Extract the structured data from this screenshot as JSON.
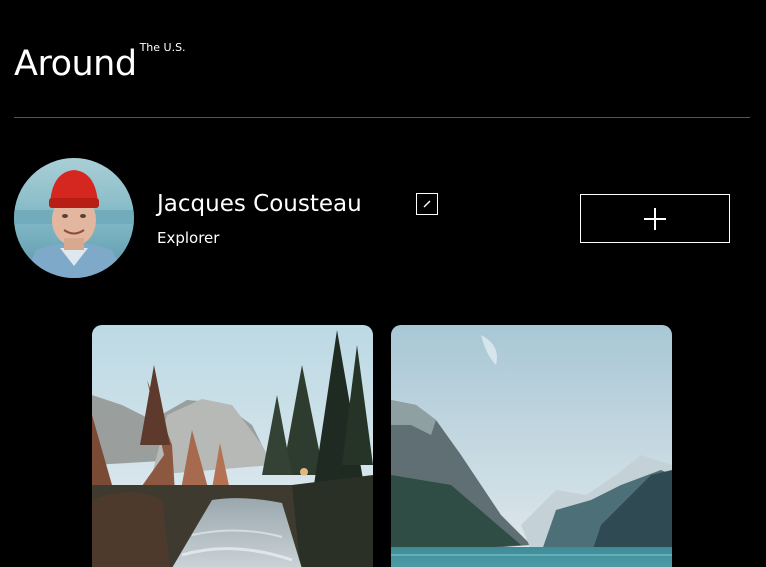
{
  "header": {
    "logo_main": "Around",
    "logo_sup": "The U.S."
  },
  "profile": {
    "name": "Jacques Cousteau",
    "job": "Explorer"
  },
  "icons": {
    "edit": "pencil-icon",
    "add": "plus-icon"
  },
  "cards": [
    {
      "image": "forest-river-photo"
    },
    {
      "image": "mountain-lake-photo"
    }
  ],
  "colors": {
    "background": "#000000",
    "text": "#ffffff",
    "divider": "#545454"
  }
}
